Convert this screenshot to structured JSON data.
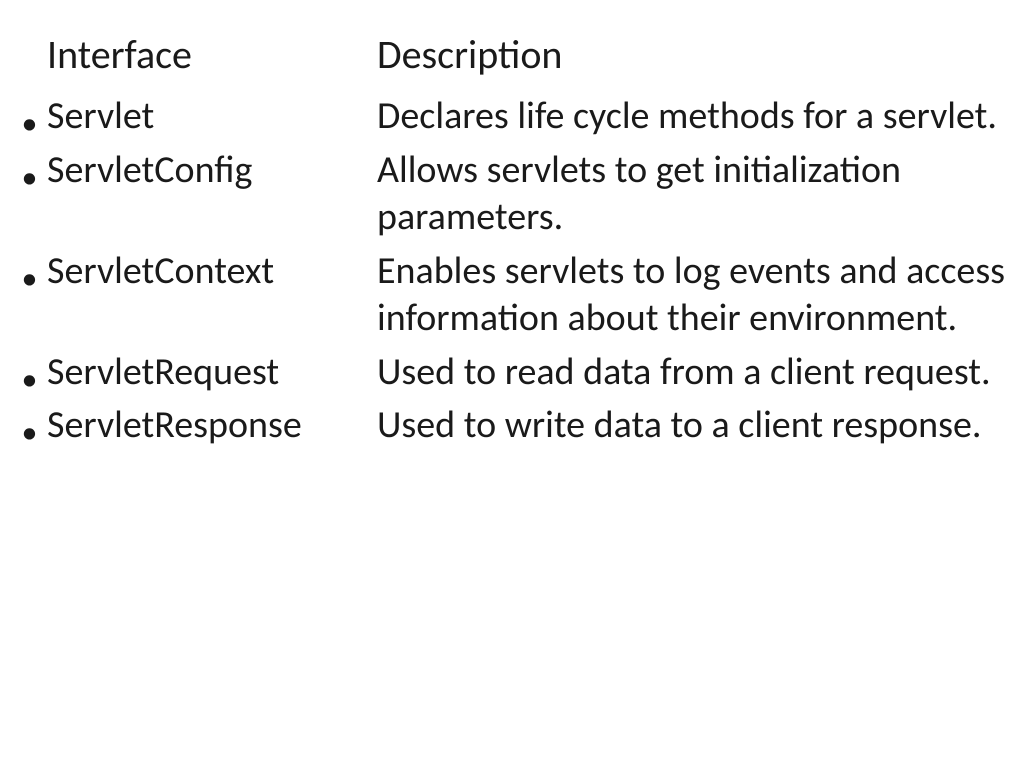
{
  "headers": {
    "left": "Interface",
    "right": "Description"
  },
  "rows": [
    {
      "name": "Servlet",
      "desc": "Declares life cycle methods for a servlet."
    },
    {
      "name": "ServletConfig",
      "desc": "Allows servlets to get initialization parameters."
    },
    {
      "name": "ServletContext",
      "desc": "Enables servlets to log events and access information about their environment."
    },
    {
      "name": "ServletRequest",
      "desc": "Used to read data from a client request."
    },
    {
      "name": "ServletResponse",
      "desc": "Used to write data to a client response."
    }
  ]
}
